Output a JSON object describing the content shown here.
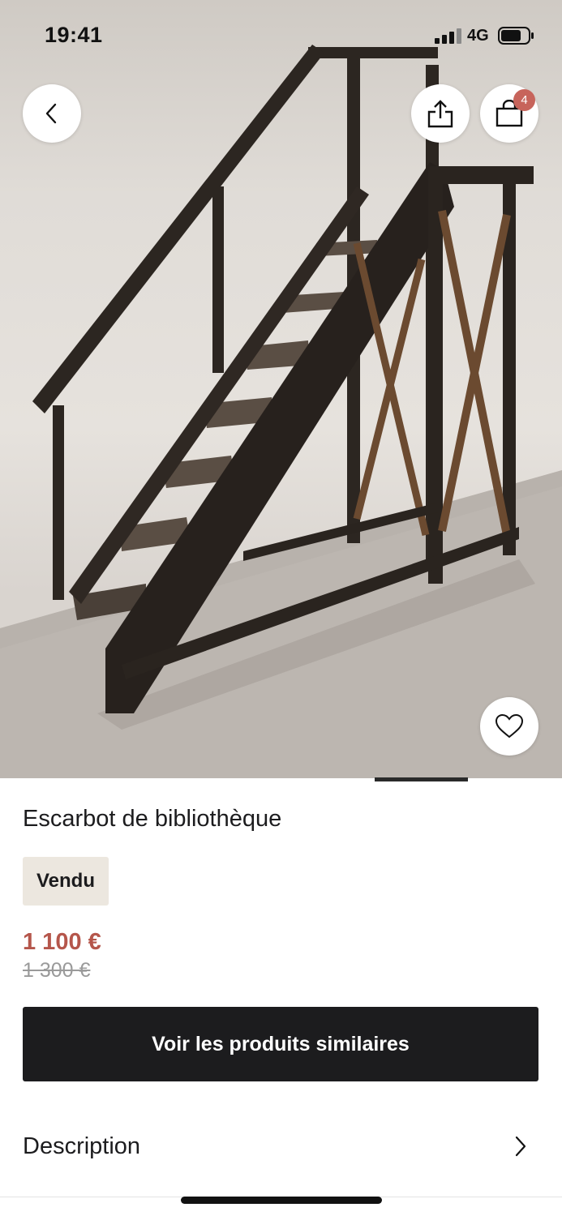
{
  "status_bar": {
    "time": "19:41",
    "network": "4G"
  },
  "header": {
    "cart_count": "4"
  },
  "hero": {
    "image_subject": "wooden library step ladder"
  },
  "product": {
    "title": "Escarbot de bibliothèque",
    "status_badge": "Vendu",
    "price": "1 100 €",
    "original_price": "1 300 €"
  },
  "actions": {
    "similar_products_label": "Voir les produits similaires"
  },
  "sections": [
    {
      "label": "Description"
    }
  ],
  "icons": [
    "back-chevron-icon",
    "share-icon",
    "shopping-bag-icon",
    "heart-icon",
    "chevron-right-icon"
  ],
  "colors": {
    "price": "#b5564b",
    "badge": "#c7645b",
    "cta_bg": "#1c1c1e",
    "sold_badge_bg": "#ece7df"
  }
}
